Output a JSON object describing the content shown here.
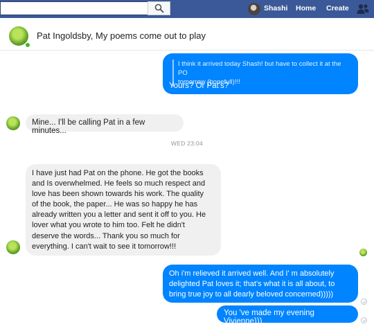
{
  "navbar": {
    "search_placeholder": "",
    "user_name": "Shashi",
    "home_label": "Home",
    "create_label": "Create",
    "icons": [
      "search-icon",
      "friends-icon"
    ]
  },
  "conversation": {
    "title": "Pat Ingoldsby, My poems come out to play",
    "timestamp_divider": "WED 23:04"
  },
  "messages": [
    {
      "direction": "outgoing",
      "reply_quote_lines": [
        "I think it arrived today Shash! but have to collect it at the PO",
        "tomorrow (hopefull)!!!"
      ],
      "text": "Yours? Or Pat's?"
    },
    {
      "direction": "incoming",
      "text": "Mine... I'll be calling Pat in a few minutes..."
    },
    {
      "direction": "incoming",
      "lines": [
        "I have just had Pat on the phone. He got the books",
        "and Is overwhelmed. He feels so much respect and",
        "love has been shown towards his work. The quality",
        "of the book, the paper... He was so happy he has",
        "already written you a letter and sent it off to you. He",
        "lover what you wrote to him too. Felt he didn't",
        "deserve the words... Thank you so much for",
        "everything. I can't wait to see it tomorrow!!!"
      ]
    },
    {
      "direction": "outgoing",
      "lines": [
        "Oh i'm relieved it arrived well. And I' m absolutely",
        "delighted Pat loves it; that's what it is all about, to",
        "bring true joy to all dearly beloved concerned)))))"
      ]
    },
    {
      "direction": "outgoing",
      "text": "You 've made my evening Vivienne)))"
    }
  ],
  "colors": {
    "navbar": "#3b5998",
    "outgoing_bubble": "#0084ff",
    "incoming_bubble": "#f1f0f0"
  }
}
